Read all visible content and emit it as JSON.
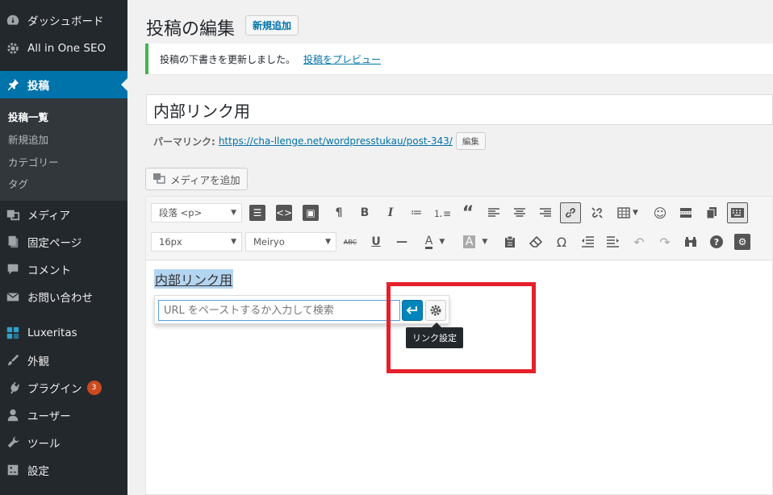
{
  "sidebar": {
    "items": [
      {
        "label": "ダッシュボード",
        "icon": "dashboard-icon"
      },
      {
        "label": "All in One SEO",
        "icon": "gear-icon"
      },
      {
        "label": "投稿",
        "icon": "pushpin-icon"
      },
      {
        "label": "メディア",
        "icon": "media-icon"
      },
      {
        "label": "固定ページ",
        "icon": "pages-icon"
      },
      {
        "label": "コメント",
        "icon": "comment-icon"
      },
      {
        "label": "お問い合わせ",
        "icon": "mail-icon"
      },
      {
        "label": "Luxeritas",
        "icon": "luxeritas-icon"
      },
      {
        "label": "外観",
        "icon": "paintbrush-icon"
      },
      {
        "label": "プラグイン",
        "icon": "plugin-icon",
        "badge": "3"
      },
      {
        "label": "ユーザー",
        "icon": "user-icon"
      },
      {
        "label": "ツール",
        "icon": "wrench-icon"
      },
      {
        "label": "設定",
        "icon": "settings-icon"
      }
    ],
    "submenu": [
      "投稿一覧",
      "新規追加",
      "カテゴリー",
      "タグ"
    ]
  },
  "header": {
    "title": "投稿の編集",
    "add_new": "新規追加"
  },
  "notice": {
    "text": "投稿の下書きを更新しました。",
    "link": "投稿をプレビュー"
  },
  "post": {
    "title": "内部リンク用",
    "permalink_label": "パーマリンク:",
    "permalink_url": "https://cha-llenge.net/wordpresstukau/post-343/",
    "edit_label": "編集"
  },
  "media_button": "メディアを追加",
  "toolbar": {
    "format_select": "段落 <p>",
    "font_size": "16px",
    "font_family": "Meiryo"
  },
  "content": {
    "selected_text": "内部リンク用"
  },
  "link_popup": {
    "placeholder": "URL をペーストするか入力して検索",
    "tooltip": "リンク設定"
  },
  "colors": {
    "sidebar_bg": "#23282d",
    "accent": "#0073aa",
    "notice_border": "#46b450",
    "highlight_box": "#e5202a"
  }
}
